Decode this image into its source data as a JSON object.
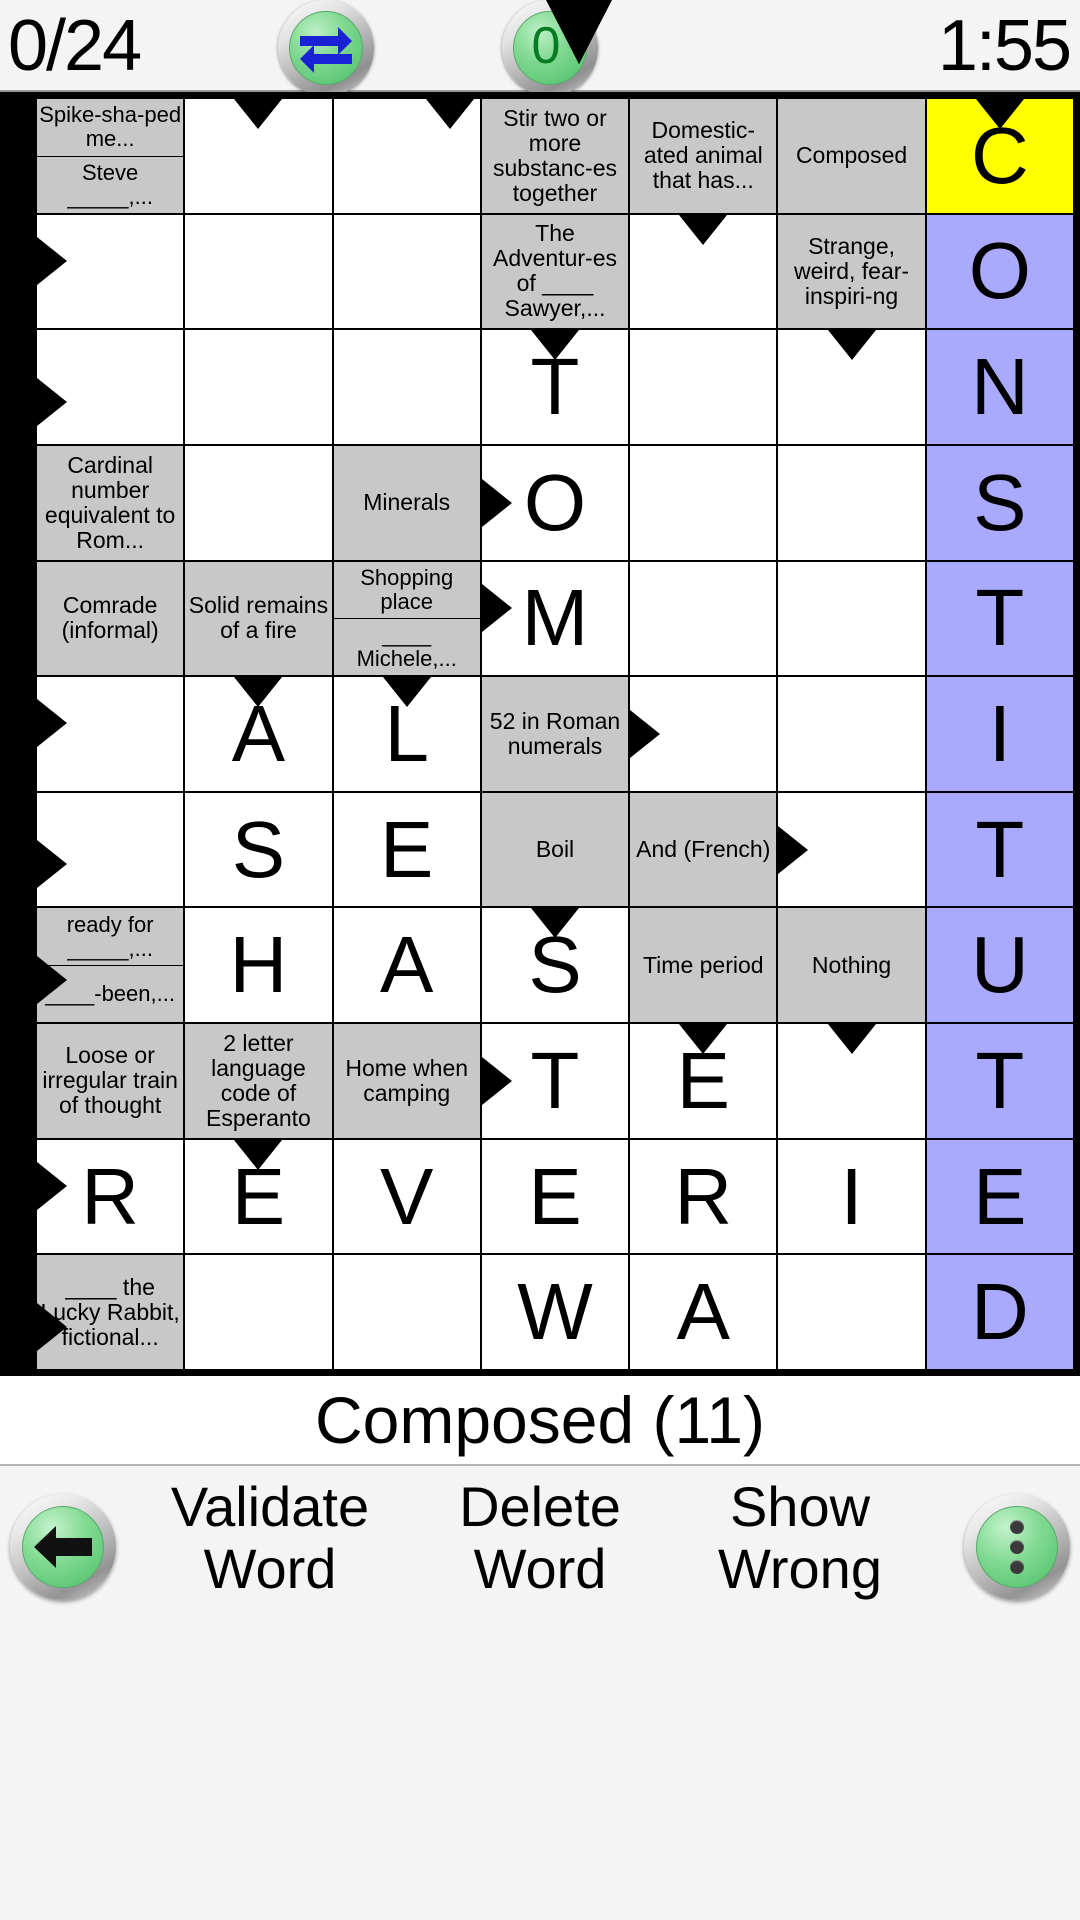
{
  "topbar": {
    "progress": "0/24",
    "timer": "1:55",
    "swap_icon": "swap-arrows-icon",
    "hint_icon": "hint-triangle-icon",
    "hint_count": "0"
  },
  "current_clue": "Composed (11)",
  "bottombar": {
    "back_icon": "back-arrow-icon",
    "menu_icon": "overflow-menu-icon",
    "validate_label": "Validate\nWord",
    "validate_line1": "Validate",
    "validate_line2": "Word",
    "delete_line1": "Delete",
    "delete_line2": "Word",
    "show_line1": "Show",
    "show_line2": "Wrong"
  },
  "colors": {
    "clue_bg": "#c8c8c8",
    "cell_bg": "#ffffff",
    "active_cell": "#ffff00",
    "selected_word": "#a9a9fd",
    "grid_border": "#000000",
    "chrome_bg": "#f4f4f4"
  },
  "grid": {
    "columns": 7,
    "rows": 11,
    "cells": [
      [
        {
          "type": "clue",
          "split": true,
          "clue1": "Spike-sha-ped me...",
          "clue2": "Steve _____,...",
          "arrows": []
        },
        {
          "type": "letter",
          "value": "",
          "arrows": [
            "down"
          ]
        },
        {
          "type": "letter",
          "value": "",
          "arrows": [
            "down-right"
          ]
        },
        {
          "type": "clue",
          "text": "Stir two or more substanc-es together",
          "arrows": []
        },
        {
          "type": "clue",
          "text": "Domestic-ated animal that has...",
          "arrows": []
        },
        {
          "type": "clue",
          "text": "Composed",
          "arrows": []
        },
        {
          "type": "letter",
          "value": "C",
          "state": "active",
          "arrows": [
            "down"
          ]
        }
      ],
      [
        {
          "type": "letter",
          "value": "",
          "arrows": [
            "right-top"
          ]
        },
        {
          "type": "letter",
          "value": "",
          "arrows": []
        },
        {
          "type": "letter",
          "value": "",
          "arrows": []
        },
        {
          "type": "clue",
          "text": "The Adventur-es of ____ Sawyer,...",
          "arrows": []
        },
        {
          "type": "letter",
          "value": "",
          "arrows": [
            "down"
          ]
        },
        {
          "type": "clue",
          "text": "Strange, weird, fear-inspiri-ng",
          "arrows": []
        },
        {
          "type": "letter",
          "value": "O",
          "state": "selected",
          "arrows": []
        }
      ],
      [
        {
          "type": "letter",
          "value": "",
          "arrows": [
            "right-low"
          ]
        },
        {
          "type": "letter",
          "value": "",
          "arrows": []
        },
        {
          "type": "letter",
          "value": "",
          "arrows": []
        },
        {
          "type": "letter",
          "value": "T",
          "arrows": [
            "down"
          ]
        },
        {
          "type": "letter",
          "value": "",
          "arrows": []
        },
        {
          "type": "letter",
          "value": "",
          "arrows": [
            "down"
          ]
        },
        {
          "type": "letter",
          "value": "N",
          "state": "selected",
          "arrows": []
        }
      ],
      [
        {
          "type": "clue",
          "text": "Cardinal number equivalent to Rom...",
          "arrows": []
        },
        {
          "type": "letter",
          "value": "",
          "arrows": []
        },
        {
          "type": "clue",
          "text": "Minerals",
          "arrows": []
        },
        {
          "type": "letter",
          "value": "O",
          "arrows": [
            "right"
          ]
        },
        {
          "type": "letter",
          "value": "",
          "arrows": []
        },
        {
          "type": "letter",
          "value": "",
          "arrows": []
        },
        {
          "type": "letter",
          "value": "S",
          "state": "selected",
          "arrows": []
        }
      ],
      [
        {
          "type": "clue",
          "text": "Comrade (informal)",
          "arrows": []
        },
        {
          "type": "clue",
          "text": "Solid remains of a fire",
          "arrows": []
        },
        {
          "type": "clue",
          "split": true,
          "clue1": "Shopping place",
          "clue2": "____ Michele,...",
          "arrows": []
        },
        {
          "type": "letter",
          "value": "M",
          "arrows": [
            "right-top"
          ]
        },
        {
          "type": "letter",
          "value": "",
          "arrows": []
        },
        {
          "type": "letter",
          "value": "",
          "arrows": []
        },
        {
          "type": "letter",
          "value": "T",
          "state": "selected",
          "arrows": []
        }
      ],
      [
        {
          "type": "letter",
          "value": "",
          "arrows": [
            "right-top"
          ]
        },
        {
          "type": "letter",
          "value": "A",
          "arrows": [
            "down"
          ]
        },
        {
          "type": "letter",
          "value": "L",
          "arrows": [
            "down"
          ]
        },
        {
          "type": "clue",
          "text": "52 in Roman numerals",
          "arrows": []
        },
        {
          "type": "letter",
          "value": "",
          "arrows": [
            "right"
          ]
        },
        {
          "type": "letter",
          "value": "",
          "arrows": []
        },
        {
          "type": "letter",
          "value": "I",
          "state": "selected",
          "arrows": []
        }
      ],
      [
        {
          "type": "letter",
          "value": "",
          "arrows": [
            "right-low"
          ]
        },
        {
          "type": "letter",
          "value": "S",
          "arrows": []
        },
        {
          "type": "letter",
          "value": "E",
          "arrows": []
        },
        {
          "type": "clue",
          "text": "Boil",
          "arrows": []
        },
        {
          "type": "clue",
          "text": "And (French)",
          "arrows": []
        },
        {
          "type": "letter",
          "value": "",
          "arrows": [
            "right"
          ]
        },
        {
          "type": "letter",
          "value": "T",
          "state": "selected",
          "arrows": []
        }
      ],
      [
        {
          "type": "clue",
          "split": true,
          "clue1": "ready for _____,...",
          "clue2": "____-been,...",
          "arrows": [
            "right-low"
          ]
        },
        {
          "type": "letter",
          "value": "H",
          "arrows": []
        },
        {
          "type": "letter",
          "value": "A",
          "arrows": []
        },
        {
          "type": "letter",
          "value": "S",
          "arrows": [
            "down"
          ]
        },
        {
          "type": "clue",
          "text": "Time period",
          "arrows": []
        },
        {
          "type": "clue",
          "text": "Nothing",
          "arrows": []
        },
        {
          "type": "letter",
          "value": "U",
          "state": "selected",
          "arrows": []
        }
      ],
      [
        {
          "type": "clue",
          "text": "Loose or irregular train of thought",
          "arrows": []
        },
        {
          "type": "clue",
          "text": "2 letter language code of Esperanto",
          "arrows": []
        },
        {
          "type": "clue",
          "text": "Home when camping",
          "arrows": []
        },
        {
          "type": "letter",
          "value": "T",
          "arrows": [
            "right"
          ]
        },
        {
          "type": "letter",
          "value": "E",
          "arrows": [
            "down"
          ]
        },
        {
          "type": "letter",
          "value": "",
          "arrows": [
            "down"
          ]
        },
        {
          "type": "letter",
          "value": "T",
          "state": "selected",
          "arrows": []
        }
      ],
      [
        {
          "type": "letter",
          "value": "R",
          "arrows": [
            "right-top"
          ]
        },
        {
          "type": "letter",
          "value": "E",
          "arrows": [
            "down"
          ]
        },
        {
          "type": "letter",
          "value": "V",
          "arrows": []
        },
        {
          "type": "letter",
          "value": "E",
          "arrows": []
        },
        {
          "type": "letter",
          "value": "R",
          "arrows": []
        },
        {
          "type": "letter",
          "value": "I",
          "arrows": []
        },
        {
          "type": "letter",
          "value": "E",
          "state": "selected",
          "arrows": []
        }
      ],
      [
        {
          "type": "clue",
          "text": "____ the Lucky Rabbit, fictional...",
          "arrows": [
            "right-low"
          ]
        },
        {
          "type": "letter",
          "value": "",
          "arrows": []
        },
        {
          "type": "letter",
          "value": "",
          "arrows": []
        },
        {
          "type": "letter",
          "value": "W",
          "arrows": []
        },
        {
          "type": "letter",
          "value": "A",
          "arrows": []
        },
        {
          "type": "letter",
          "value": "",
          "arrows": []
        },
        {
          "type": "letter",
          "value": "D",
          "state": "selected",
          "arrows": []
        }
      ]
    ]
  }
}
